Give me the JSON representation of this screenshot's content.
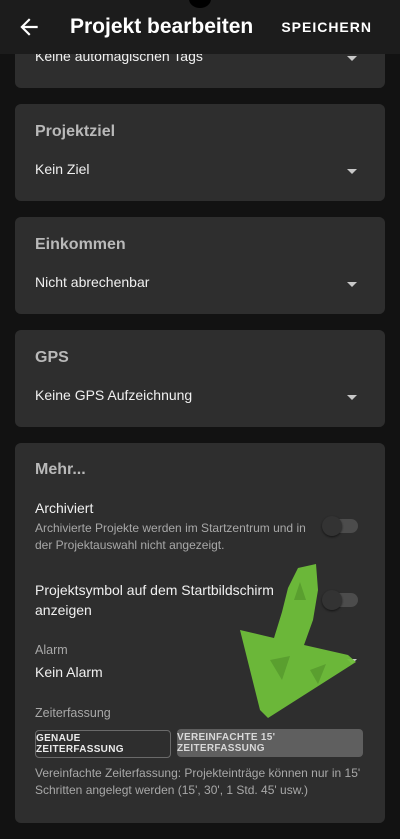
{
  "appbar": {
    "title": "Projekt bearbeiten",
    "save_label": "SPEICHERN",
    "back_icon": "arrow-left-icon"
  },
  "tags_card": {
    "value": "Keine automagischen Tags"
  },
  "goal_card": {
    "title": "Projektziel",
    "value": "Kein Ziel"
  },
  "income_card": {
    "title": "Einkommen",
    "value": "Nicht abrechenbar"
  },
  "gps_card": {
    "title": "GPS",
    "value": "Keine GPS Aufzeichnung"
  },
  "more_card": {
    "title": "Mehr...",
    "archived": {
      "title": "Archiviert",
      "description": "Archivierte Projekte werden im Startzentrum und in der Projektauswahl nicht angezeigt.",
      "enabled": false
    },
    "homescreen": {
      "title": "Projektsymbol auf dem Startbildschirm anzeigen",
      "enabled": false
    },
    "alarm": {
      "label": "Alarm",
      "value": "Kein Alarm"
    },
    "time_tracking": {
      "label": "Zeiterfassung",
      "option_exact": "GENAUE ZEITERFASSUNG",
      "option_simplified": "VEREINFACHTE 15' ZEITERFASSUNG",
      "selected": "option_simplified",
      "description": "Vereinfachte Zeiterfassung: Projekteinträge können nur in 15' Schritten angelegt werden (15', 30', 1 Std. 45' usw.)"
    }
  },
  "colors": {
    "background": "#121212",
    "card": "#2e2e2e",
    "appbar": "#1c1c1c",
    "annotation_arrow": "#6fbf3a"
  }
}
